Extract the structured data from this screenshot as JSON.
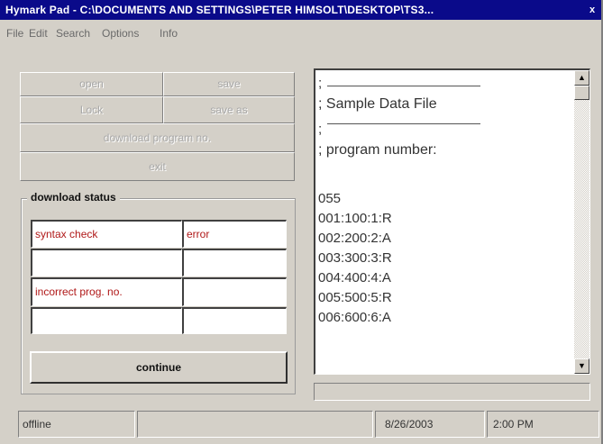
{
  "window": {
    "title": "Hymark  Pad - C:\\DOCUMENTS AND SETTINGS\\PETER HIMSOLT\\DESKTOP\\TS3...",
    "close_glyph": "x"
  },
  "menu": {
    "items": [
      {
        "label": "File"
      },
      {
        "label": "Edit"
      },
      {
        "label": "Search"
      },
      {
        "label": "Options"
      },
      {
        "label": "Info"
      }
    ]
  },
  "buttons": {
    "open": "open",
    "save": "save",
    "lock": "Lock",
    "save_as": "save as",
    "download_program": "download program no.",
    "exit": "exit",
    "continue": "continue"
  },
  "download_status": {
    "title": "download status",
    "rows": [
      [
        "syntax check",
        "error"
      ],
      [
        "",
        ""
      ],
      [
        "incorrect prog. no.",
        ""
      ],
      [
        "",
        ""
      ]
    ]
  },
  "editor": {
    "lines": [
      ";",
      "; Sample Data File",
      ";",
      "; program number:",
      "",
      "055",
      "001:100:1:R",
      "002:200:2:A",
      "003:300:3:R",
      "004:400:4:A",
      "005:500:5:R",
      "006:600:6:A"
    ]
  },
  "progress": {
    "value": 0
  },
  "status": {
    "connection": "offline",
    "info": "",
    "date": "8/26/2003",
    "time": "2:00 PM"
  },
  "colors": {
    "titlebar": "#0a0a8a",
    "face": "#d4d0c8",
    "status_text": "#b01818"
  }
}
